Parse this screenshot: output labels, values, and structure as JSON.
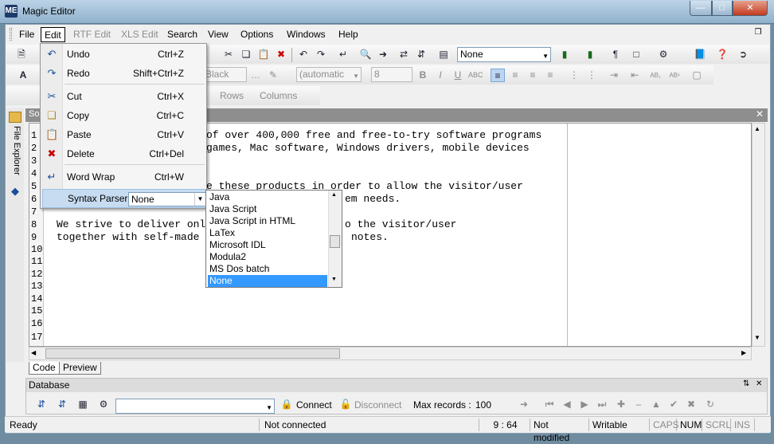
{
  "window": {
    "title": "Magic Editor",
    "app_icon": "ME"
  },
  "menubar": [
    "File",
    "Edit",
    "RTF Edit",
    "XLS Edit",
    "Search",
    "View",
    "Options",
    "Windows",
    "Help"
  ],
  "toolbar1": {
    "syntax_combo": "None"
  },
  "toolbar2": {
    "color_combo": "Black",
    "color2_combo": "(automatic",
    "size_combo": "8"
  },
  "toolbar3": {
    "rows": "Rows",
    "columns": "Columns"
  },
  "side_tab": {
    "label": "File Explorer"
  },
  "doc_tab": {
    "label": "So"
  },
  "line_numbers": [
    "1",
    "2",
    "3",
    "4",
    "5",
    "6",
    "7",
    "8",
    "9",
    "10",
    "11",
    "12",
    "13",
    "14",
    "15",
    "16",
    "17"
  ],
  "code_lines": [
    "of over 400,000 free and free-to-try software programs",
    "games, Mac software, Windows drivers, mobile devices",
    "",
    "",
    "e these products in order to allow the visitor/user",
    "em needs.",
    "",
    "We strive to deliver onl",
    "together with self-made"
  ],
  "code_lines_right": [
    "o the visitor/user",
    "notes."
  ],
  "bottom_tabs": [
    "Code",
    "Preview"
  ],
  "database": {
    "title": "Database",
    "connect": "Connect",
    "disconnect": "Disconnect",
    "max_records_label": "Max records :",
    "max_records_value": "100"
  },
  "statusbar": {
    "state": "Ready",
    "connection": "Not connected",
    "position": "9 : 64",
    "modified": "Not modified",
    "mode": "Writable",
    "caps": "CAPS",
    "num": "NUM",
    "scrl": "SCRL",
    "ins": "INS"
  },
  "edit_menu": {
    "undo": {
      "label": "Undo",
      "shortcut": "Ctrl+Z"
    },
    "redo": {
      "label": "Redo",
      "shortcut": "Shift+Ctrl+Z"
    },
    "cut": {
      "label": "Cut",
      "shortcut": "Ctrl+X"
    },
    "copy": {
      "label": "Copy",
      "shortcut": "Ctrl+C"
    },
    "paste": {
      "label": "Paste",
      "shortcut": "Ctrl+V"
    },
    "delete": {
      "label": "Delete",
      "shortcut": "Ctrl+Del"
    },
    "word_wrap": {
      "label": "Word Wrap",
      "shortcut": "Ctrl+W"
    },
    "syntax_parser": {
      "label": "Syntax Parser",
      "value": "None"
    }
  },
  "parser_options": [
    "Java",
    "Java Script",
    "Java Script in HTML",
    "LaTex",
    "Microsoft IDL",
    "Modula2",
    "MS Dos batch",
    "None"
  ],
  "parser_selected": "None"
}
